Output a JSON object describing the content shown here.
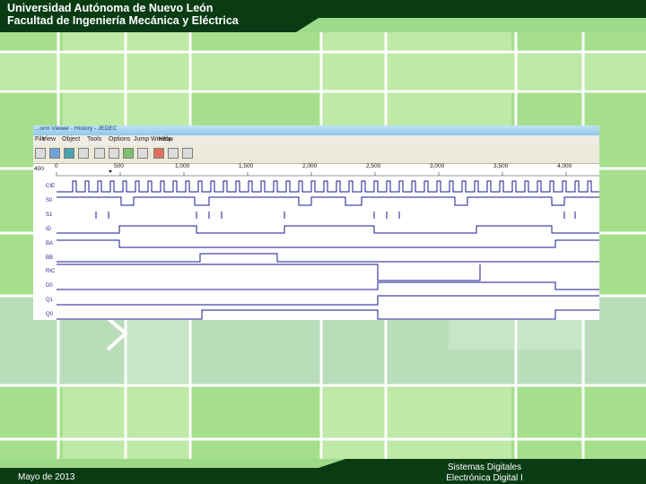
{
  "header": {
    "line1": "Universidad Autónoma de Nuevo León",
    "line2": "Facultad de Ingeniería Mecánica y Eléctrica"
  },
  "footer": {
    "date": "Mayo de 2013",
    "right_line1": "Sistemas Digitales",
    "right_line2": "Electrónica Digital I"
  },
  "colors": {
    "bar": "#0a3c14",
    "background": "#9fd98a",
    "wave": "#1a1a8c"
  },
  "simulator": {
    "title": "...orm Viewer - History - JEDEC",
    "menu": [
      "File",
      "View",
      "Object",
      "Tools",
      "Options",
      "Jump Window",
      "Help"
    ],
    "ruler": {
      "start_label": "400",
      "ticks": [
        "0",
        "500",
        "1,000",
        "1,500",
        "2,000",
        "2,500",
        "3,000",
        "3,500",
        "4,000"
      ]
    },
    "signals": [
      "CIE",
      "S0",
      "S1",
      "ID",
      "BA",
      "BB",
      "RIC",
      "D0",
      "Q1",
      "Q0"
    ]
  }
}
